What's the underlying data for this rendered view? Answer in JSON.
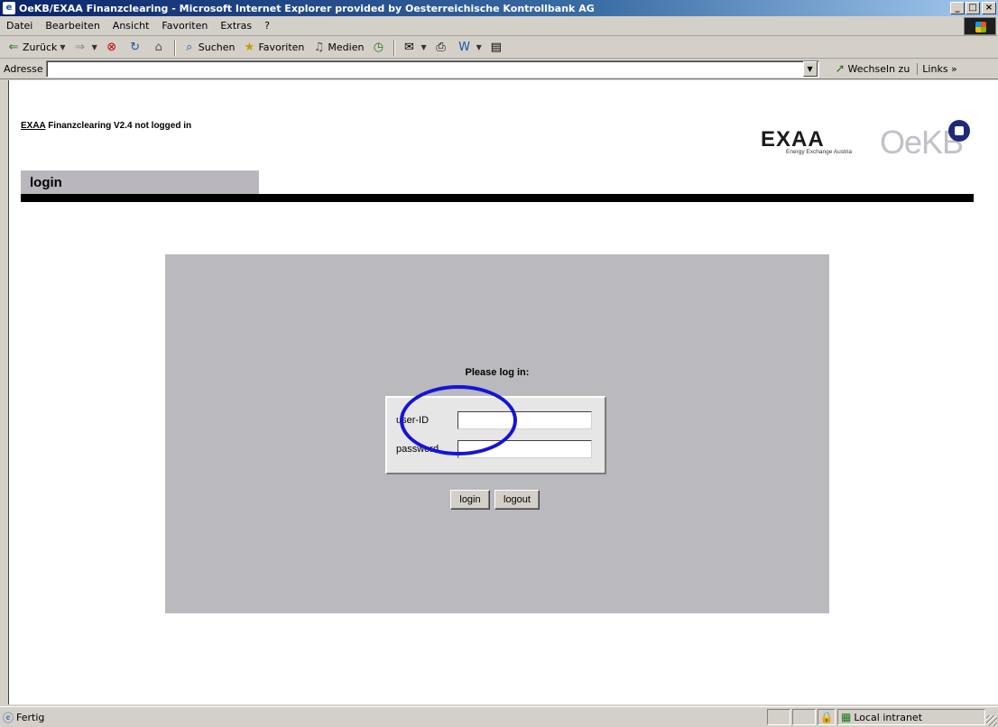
{
  "window": {
    "title": "OeKB/EXAA Finanzclearing - Microsoft Internet Explorer provided by Oesterreichische Kontrollbank AG",
    "controls": {
      "minimize": "_",
      "maximize": "□",
      "close": "×"
    }
  },
  "menu": [
    {
      "label": "Datei"
    },
    {
      "label": "Bearbeiten"
    },
    {
      "label": "Ansicht"
    },
    {
      "label": "Favoriten"
    },
    {
      "label": "Extras"
    },
    {
      "label": "?"
    }
  ],
  "toolbar": {
    "back": "Zurück",
    "search": "Suchen",
    "favorites": "Favoriten",
    "media": "Medien"
  },
  "address": {
    "label": "Adresse",
    "value": "",
    "go": "Wechseln zu",
    "links": "Links »"
  },
  "page": {
    "app_link": "EXAA",
    "status_title": "Finanzclearing V2.4 not logged in",
    "tab_label": "login",
    "prompt": "Please log in:",
    "userid_label": "user-ID",
    "userid_value": "",
    "password_label": "password",
    "password_value": "",
    "login_button": "login",
    "logout_button": "logout"
  },
  "logos": {
    "exaa_text": "EXAA",
    "exaa_sub": "Energy Exchange Austria",
    "oekb_text": "OeKB"
  },
  "statusbar": {
    "status": "Fertig",
    "zone": "Local intranet"
  },
  "colors": {
    "annotation_circle": "#1414d8",
    "panel_gray": "#bab9bd",
    "titlebar_start": "#0a246a"
  }
}
